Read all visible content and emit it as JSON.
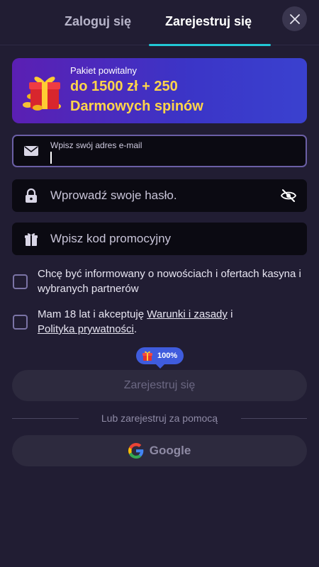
{
  "tabs": {
    "login": "Zaloguj się",
    "register": "Zarejestruj się"
  },
  "banner": {
    "subtitle": "Pakiet powitalny",
    "line1": "do 1500 zł + 250",
    "line2": "Darmowych spinów"
  },
  "form": {
    "email_label": "Wpisz swój adres e-mail",
    "email_value": "",
    "password_placeholder": "Wprowadź swoje hasło.",
    "promo_placeholder": "Wpisz kod promocyjny"
  },
  "consents": {
    "marketing": "Chcę być informowany o nowościach i ofertach kasyna i wybranych partnerów",
    "terms_prefix": "Mam 18 lat i akceptuję ",
    "terms_link": "Warunki i zasady",
    "terms_and": " i",
    "privacy_link": "Polityka prywatności",
    "terms_suffix": "."
  },
  "progress_badge": {
    "value_text": "100%",
    "percent": 100
  },
  "submit_label": "Zarejestruj się",
  "divider_text": "Lub zarejestruj za pomocą",
  "google_label": "Google",
  "colors": {
    "background": "#211d33",
    "accent_cyan": "#22c7d6",
    "banner_gold": "#ffd54a",
    "badge_blue": "#3f5cdd"
  }
}
